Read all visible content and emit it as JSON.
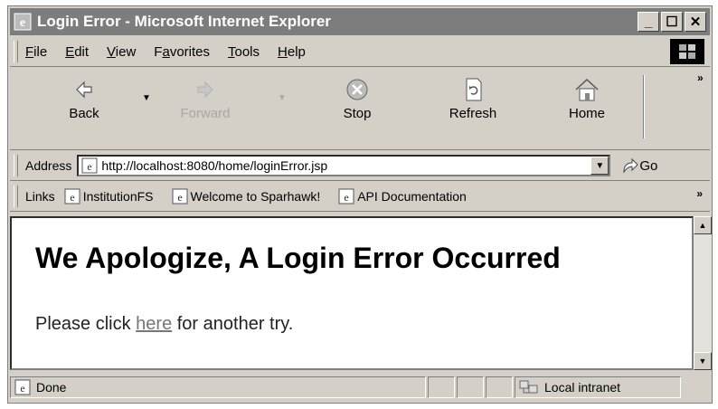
{
  "window": {
    "title": "Login Error - Microsoft Internet Explorer"
  },
  "menu": {
    "items": [
      {
        "label": "File",
        "key": "F",
        "rest": "ile"
      },
      {
        "label": "Edit",
        "key": "E",
        "rest": "dit"
      },
      {
        "label": "View",
        "key": "V",
        "rest": "iew"
      },
      {
        "label": "Favorites",
        "pre": "F",
        "key": "a",
        "rest": "vorites"
      },
      {
        "label": "Tools",
        "key": "T",
        "rest": "ools"
      },
      {
        "label": "Help",
        "key": "H",
        "rest": "elp"
      }
    ]
  },
  "toolbar": {
    "back": "Back",
    "forward": "Forward",
    "stop": "Stop",
    "refresh": "Refresh",
    "home": "Home",
    "more": "»"
  },
  "address": {
    "label": "Address",
    "url": "http://localhost:8080/home/loginError.jsp",
    "go": "Go"
  },
  "links": {
    "label": "Links",
    "items": [
      "InstitutionFS",
      "Welcome to Sparhawk!",
      "API Documentation"
    ],
    "more": "»"
  },
  "page": {
    "heading": "We Apologize, A Login Error Occurred",
    "text_before": "Please click ",
    "link": "here",
    "text_after": " for another try."
  },
  "status": {
    "text": "Done",
    "zone": "Local intranet"
  },
  "colors": {
    "titlebar": "#7d7d7d",
    "chrome": "#d4d0c8",
    "link": "#777777"
  }
}
